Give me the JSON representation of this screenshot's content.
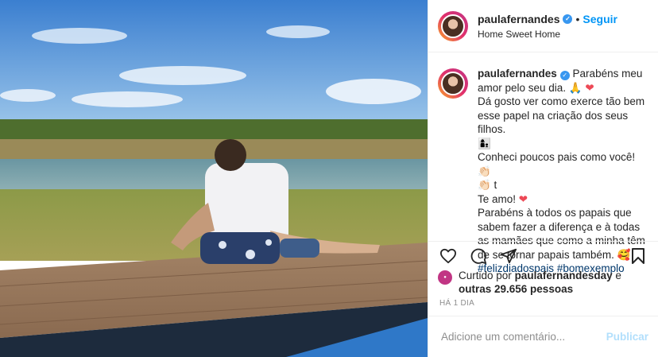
{
  "post": {
    "username": "paulafernandes",
    "follow_label": "Seguir",
    "dot": "•",
    "location": "Home Sweet Home"
  },
  "caption": {
    "username": "paulafernandes",
    "line1": "Parabéns meu amor pelo seu dia. 🙏",
    "line2": "Dá gosto ver como exerce tão bem esse papel na criação dos seus filhos.",
    "line3": "👩‍👦",
    "line4": "Conheci poucos pais como você! 👏🏻",
    "line5": "👏🏻 t",
    "line6": "Te amo!",
    "line7": "Parabéns à todos os papais que sabem fazer a diferença e à todas as mamães que como a minha têm de se tornar papais também. 🥰",
    "hashtag1": "#felizdiadospais",
    "hashtag2": "#bomexemplo",
    "heart": "❤"
  },
  "likes": {
    "prefix": "Curtido por",
    "user": "paulafernandesday",
    "conj": "e",
    "others": "outras 29.656 pessoas"
  },
  "time_label": "HÁ 1 DIA",
  "comment": {
    "placeholder": "Adicione um comentário...",
    "post_label": "Publicar"
  },
  "icons": [
    "heart-icon",
    "comment-icon",
    "share-icon",
    "bookmark-icon",
    "verified-icon"
  ],
  "colors": {
    "accent": "#0095f6",
    "heart": "#ed4956",
    "hashtag": "#00376b",
    "verified": "#3897f0"
  }
}
